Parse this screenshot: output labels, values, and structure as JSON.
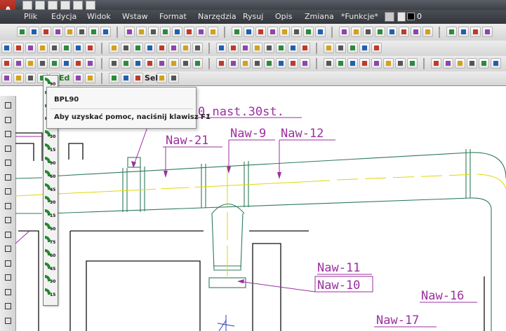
{
  "menu": {
    "items": [
      {
        "label": "Plik"
      },
      {
        "label": "Edycja"
      },
      {
        "label": "Widok"
      },
      {
        "label": "Wstaw"
      },
      {
        "label": "Format"
      },
      {
        "label": "Narzędzia"
      },
      {
        "label": "Rysuj"
      },
      {
        "label": "Opis"
      },
      {
        "label": "Zmiana"
      },
      {
        "label": "*Funkcje*"
      }
    ],
    "layer_value": "0"
  },
  "toolbar_text": {
    "ed": "Ed",
    "sel": "Sel",
    "flyout_top": "90"
  },
  "flyout": {
    "items": [
      "90",
      "75",
      "60",
      "45",
      "30",
      "15",
      "90",
      "60",
      "45",
      "30",
      "15",
      "90",
      "75",
      "60",
      "45",
      "30",
      "15"
    ]
  },
  "tooltip": {
    "title": "BPL90",
    "help": "Aby uzyskać pomoc, naciśnij klawisz F1"
  },
  "drawing": {
    "labels": {
      "top_partial": "0,nast.30st.",
      "naw21": "Naw-21",
      "naw9": "Naw-9",
      "naw12": "Naw-12",
      "naw11": "Naw-11",
      "naw10": "Naw-10",
      "naw16": "Naw-16",
      "naw17": "Naw-17"
    }
  },
  "colors": {
    "pipe": "#2f7a5a",
    "label": "#9b2fa0",
    "centerline": "#e0d800",
    "walls": "#111111"
  }
}
